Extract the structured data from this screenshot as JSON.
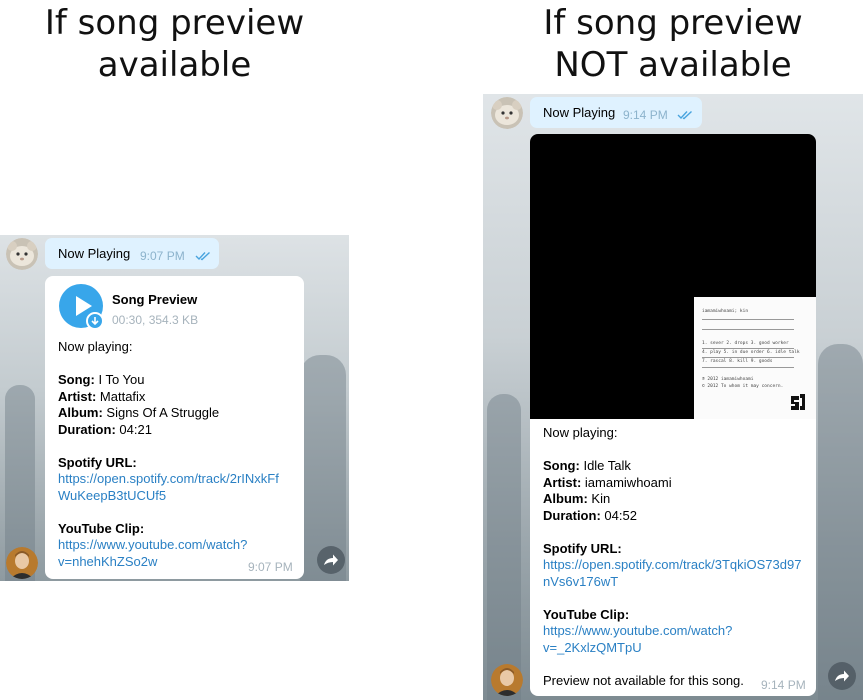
{
  "headings": {
    "left_line1": "If song preview",
    "left_line2": "available",
    "right_line1": "If song preview",
    "right_line2": "NOT available"
  },
  "left": {
    "header_bubble": {
      "label": "Now Playing",
      "time": "9:07 PM",
      "icon": "double-check-icon"
    },
    "audio": {
      "title": "Song Preview",
      "meta": "00:30, 354.3 KB",
      "icon": "play-icon",
      "badge_icon": "download-icon"
    },
    "intro": "Now playing:",
    "song_label": "Song:",
    "song": "I To You",
    "artist_label": "Artist:",
    "artist": "Mattafix",
    "album_label": "Album:",
    "album": "Signs Of A Struggle",
    "duration_label": "Duration:",
    "duration": "04:21",
    "spotify_label": "Spotify URL:",
    "spotify_line1": "https://open.spotify.com/track/2rINxkFf",
    "spotify_line2": "WuKeepB3tUCUf5",
    "youtube_label": "YouTube Clip:",
    "youtube_line1": "https://www.youtube.com/watch?",
    "youtube_line2": "v=nhehKhZSo2w",
    "time": "9:07 PM",
    "forward_icon": "forward-icon"
  },
  "right": {
    "header_bubble": {
      "label": "Now Playing",
      "time": "9:14 PM",
      "icon": "double-check-icon"
    },
    "cover": {
      "header": "iamamiwhoami; kin",
      "tracks_1": "1. sever 2. drops 3. good worker",
      "tracks_2": "4. play 5. in due order 6. idle talk",
      "tracks_3": "7. rascal 8. kill 9. goods",
      "copy_1": "℗ 2012 iamamiwhoami",
      "copy_2": "© 2012 To whom it may concern."
    },
    "intro": "Now playing:",
    "song_label": "Song:",
    "song": "Idle Talk",
    "artist_label": "Artist:",
    "artist": "iamamiwhoami",
    "album_label": "Album:",
    "album": "Kin",
    "duration_label": "Duration:",
    "duration": "04:52",
    "spotify_label": "Spotify URL:",
    "spotify_line1": "https://open.spotify.com/track/3TqkiOS73d97",
    "spotify_line2": "nVs6v176wT",
    "youtube_label": "YouTube Clip:",
    "youtube_line1": "https://www.youtube.com/watch?",
    "youtube_line2": "v=_2KxlzQMTpU",
    "note": "Preview not available for this song.",
    "time": "9:14 PM",
    "forward_icon": "forward-icon"
  },
  "colors": {
    "bubble": "#dff2ff",
    "link": "#2a80c4",
    "accent": "#38a6ea",
    "meta": "#a6b3bc"
  }
}
